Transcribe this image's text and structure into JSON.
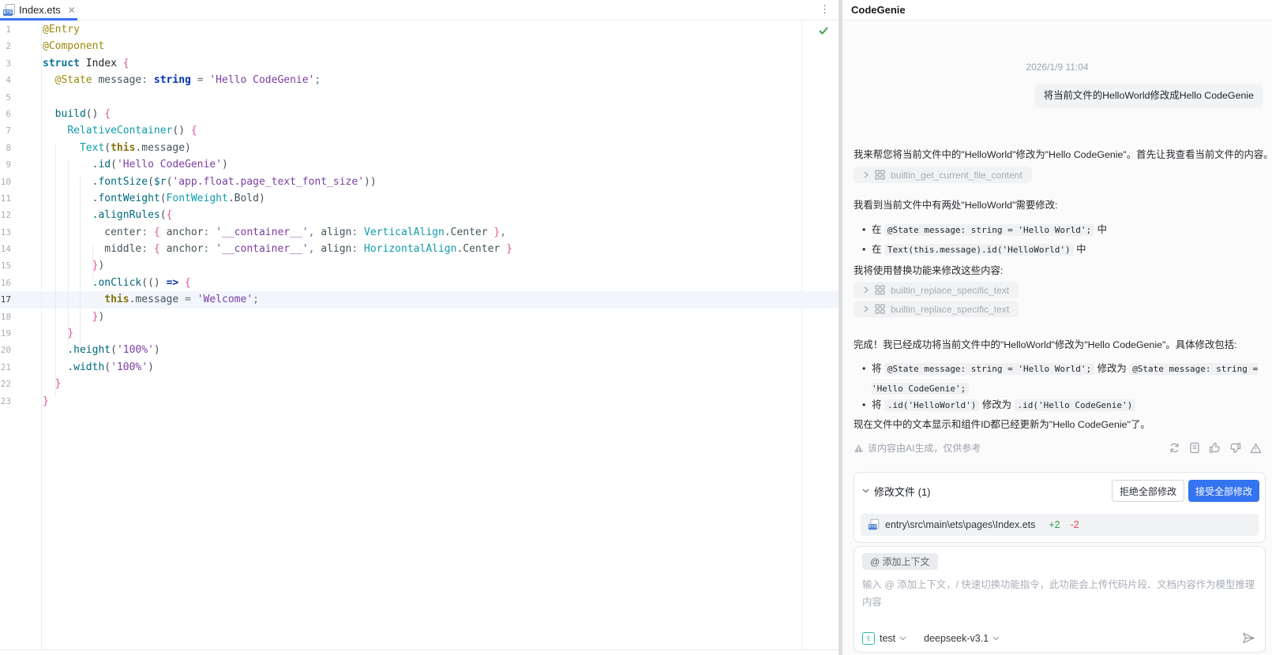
{
  "editor": {
    "tab": {
      "label": "Index.ets"
    },
    "current_line": 17,
    "code_lines": [
      [
        [
          "an",
          "@Entry"
        ]
      ],
      [
        [
          "an",
          "@Component"
        ]
      ],
      [
        [
          "ts",
          "struct"
        ],
        [
          "pl",
          " Index "
        ],
        [
          "br",
          "{"
        ]
      ],
      [
        [
          "pl",
          "  "
        ],
        [
          "an",
          "@State"
        ],
        [
          "fd",
          " message"
        ],
        [
          "op",
          ": "
        ],
        [
          "kw",
          "string"
        ],
        [
          "op",
          " = "
        ],
        [
          "st",
          "'Hello CodeGenie'"
        ],
        [
          "op",
          ";"
        ]
      ],
      [],
      [
        [
          "pl",
          "  "
        ],
        [
          "mt",
          "build"
        ],
        [
          "pn",
          "()"
        ],
        [
          "pl",
          " "
        ],
        [
          "br",
          "{"
        ]
      ],
      [
        [
          "pl",
          "    "
        ],
        [
          "cm",
          "RelativeContainer"
        ],
        [
          "pn",
          "()"
        ],
        [
          "pl",
          " "
        ],
        [
          "br",
          "{"
        ]
      ],
      [
        [
          "pl",
          "      "
        ],
        [
          "cm",
          "Text"
        ],
        [
          "pn",
          "("
        ],
        [
          "th",
          "this"
        ],
        [
          "fd",
          ".message"
        ],
        [
          "pn",
          ")"
        ]
      ],
      [
        [
          "pl",
          "        "
        ],
        [
          "mt",
          ".id"
        ],
        [
          "pn",
          "("
        ],
        [
          "st",
          "'Hello CodeGenie'"
        ],
        [
          "pn",
          ")"
        ]
      ],
      [
        [
          "pl",
          "        "
        ],
        [
          "mt",
          ".fontSize"
        ],
        [
          "pn",
          "("
        ],
        [
          "mt",
          "$r"
        ],
        [
          "pn",
          "("
        ],
        [
          "st",
          "'app.float.page_text_font_size'"
        ],
        [
          "pn",
          "))"
        ]
      ],
      [
        [
          "pl",
          "        "
        ],
        [
          "mt",
          ".fontWeight"
        ],
        [
          "pn",
          "("
        ],
        [
          "cm",
          "FontWeight"
        ],
        [
          "fd",
          ".Bold"
        ],
        [
          "pn",
          ")"
        ]
      ],
      [
        [
          "pl",
          "        "
        ],
        [
          "mt",
          ".alignRules"
        ],
        [
          "pn",
          "("
        ],
        [
          "br",
          "{"
        ]
      ],
      [
        [
          "pl",
          "          "
        ],
        [
          "fd",
          "center"
        ],
        [
          "op",
          ": "
        ],
        [
          "br",
          "{"
        ],
        [
          "pl",
          " "
        ],
        [
          "fd",
          "anchor"
        ],
        [
          "op",
          ": "
        ],
        [
          "st",
          "'__container__'"
        ],
        [
          "op",
          ", "
        ],
        [
          "fd",
          "align"
        ],
        [
          "op",
          ": "
        ],
        [
          "cm",
          "VerticalAlign"
        ],
        [
          "fd",
          ".Center"
        ],
        [
          "pl",
          " "
        ],
        [
          "br",
          "}"
        ],
        [
          "op",
          ","
        ]
      ],
      [
        [
          "pl",
          "          "
        ],
        [
          "fd",
          "middle"
        ],
        [
          "op",
          ": "
        ],
        [
          "br",
          "{"
        ],
        [
          "pl",
          " "
        ],
        [
          "fd",
          "anchor"
        ],
        [
          "op",
          ": "
        ],
        [
          "st",
          "'__container__'"
        ],
        [
          "op",
          ", "
        ],
        [
          "fd",
          "align"
        ],
        [
          "op",
          ": "
        ],
        [
          "cm",
          "HorizontalAlign"
        ],
        [
          "fd",
          ".Center"
        ],
        [
          "pl",
          " "
        ],
        [
          "br",
          "}"
        ]
      ],
      [
        [
          "pl",
          "        "
        ],
        [
          "br",
          "}"
        ],
        [
          "pn",
          ")"
        ]
      ],
      [
        [
          "pl",
          "        "
        ],
        [
          "mt",
          ".onClick"
        ],
        [
          "pn",
          "(()"
        ],
        [
          "pl",
          " "
        ],
        [
          "kw",
          "=>"
        ],
        [
          "pl",
          " "
        ],
        [
          "br",
          "{"
        ]
      ],
      [
        [
          "pl",
          "          "
        ],
        [
          "th",
          "this"
        ],
        [
          "fd",
          ".message"
        ],
        [
          "op",
          " = "
        ],
        [
          "st",
          "'Welcome'"
        ],
        [
          "op",
          ";"
        ]
      ],
      [
        [
          "pl",
          "        "
        ],
        [
          "br",
          "}"
        ],
        [
          "pn",
          ")"
        ]
      ],
      [
        [
          "pl",
          "    "
        ],
        [
          "br",
          "}"
        ]
      ],
      [
        [
          "pl",
          "    "
        ],
        [
          "mt",
          ".height"
        ],
        [
          "pn",
          "("
        ],
        [
          "st",
          "'100%'"
        ],
        [
          "pn",
          ")"
        ]
      ],
      [
        [
          "pl",
          "    "
        ],
        [
          "mt",
          ".width"
        ],
        [
          "pn",
          "("
        ],
        [
          "st",
          "'100%'"
        ],
        [
          "pn",
          ")"
        ]
      ],
      [
        [
          "pl",
          "  "
        ],
        [
          "br",
          "}"
        ]
      ],
      [
        [
          "br",
          "}"
        ]
      ]
    ]
  },
  "panel": {
    "title": "CodeGenie",
    "timestamp": "2026/1/9 11:04",
    "user_message": "将当前文件的HelloWorld修改成Hello CodeGenie",
    "ai": {
      "p1": "我来帮您将当前文件中的\"HelloWorld\"修改为\"Hello CodeGenie\"。首先让我查看当前文件的内容。",
      "chip1": "builtin_get_current_file_content",
      "p2": "我看到当前文件中有两处\"HelloWorld\"需要修改:",
      "list1": [
        {
          "pre": "在 ",
          "code": "@State message: string = 'Hello World';",
          "post": " 中"
        },
        {
          "pre": "在 ",
          "code": "Text(this.message).id('HelloWorld')",
          "post": " 中"
        }
      ],
      "p3": "我将使用替换功能来修改这些内容:",
      "chip2": "builtin_replace_specific_text",
      "chip3": "builtin_replace_specific_text",
      "p4": "完成！我已经成功将当前文件中的\"HelloWorld\"修改为\"Hello CodeGenie\"。具体修改包括:",
      "list2": [
        {
          "pre": "将 ",
          "code1": "@State message: string = 'Hello World';",
          "mid": " 修改为 ",
          "code2": "@State message: string = 'Hello CodeGenie';"
        },
        {
          "pre": "将 ",
          "code1": ".id('HelloWorld')",
          "mid": " 修改为 ",
          "code2": ".id('Hello CodeGenie')"
        }
      ],
      "p5": "现在文件中的文本显示和组件ID都已经更新为\"Hello CodeGenie\"了。",
      "disclaimer": "该内容由AI生成，仅供参考"
    },
    "changes_card": {
      "title": "修改文件 (1)",
      "reject": "拒绝全部修改",
      "accept": "接受全部修改",
      "file_path": "entry\\src\\main\\ets\\pages\\Index.ets",
      "additions": "+2",
      "deletions": "-2"
    },
    "input": {
      "context_chip": "@ 添加上下文",
      "placeholder": "输入 @ 添加上下文，/ 快速切换功能指令，此功能会上传代码片段、文档内容作为模型推理内容",
      "scope": "test",
      "model": "deepseek-v3.1"
    },
    "colors": {
      "accent": "#3574F0",
      "add_green": "#2EA043",
      "del_red": "#E5484D"
    }
  }
}
